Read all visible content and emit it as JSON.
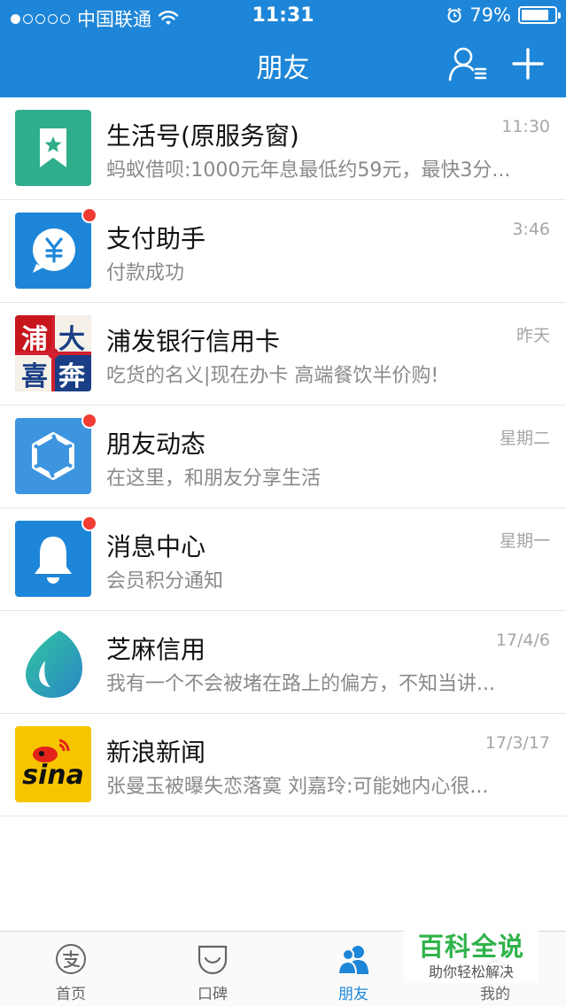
{
  "status_bar": {
    "carrier": "中国联通",
    "time": "11:31",
    "battery": "79%"
  },
  "nav": {
    "title": "朋友"
  },
  "conversations": [
    {
      "title": "生活号(原服务窗)",
      "subtitle": "蚂蚁借呗:1000元年息最低约59元，最快3分...",
      "time": "11:30",
      "icon": "bookmark-star-icon",
      "unread": false
    },
    {
      "title": "支付助手",
      "subtitle": "付款成功",
      "time": "3:46",
      "icon": "yen-bubble-icon",
      "unread": true
    },
    {
      "title": "浦发银行信用卡",
      "subtitle": "吃货的名义|现在办卡 高端餐饮半价购!",
      "time": "昨天",
      "icon": "spdb-promo-image",
      "unread": false,
      "avatar_text": [
        "浦",
        "大",
        "喜",
        "奔"
      ]
    },
    {
      "title": "朋友动态",
      "subtitle": "在这里，和朋友分享生活",
      "time": "星期二",
      "icon": "aperture-icon",
      "unread": true
    },
    {
      "title": "消息中心",
      "subtitle": "会员积分通知",
      "time": "星期一",
      "icon": "bell-icon",
      "unread": true
    },
    {
      "title": "芝麻信用",
      "subtitle": "我有一个不会被堵在路上的偏方，不知当讲...",
      "time": "17/4/6",
      "icon": "sesame-drop-icon",
      "unread": false
    },
    {
      "title": "新浪新闻",
      "subtitle": "张曼玉被曝失恋落寞 刘嘉玲:可能她内心很...",
      "time": "17/3/17",
      "icon": "sina-logo",
      "unread": false,
      "avatar_text": [
        "sina"
      ]
    }
  ],
  "tabs": [
    {
      "label": "首页",
      "icon": "alipay-icon",
      "active": false
    },
    {
      "label": "口碑",
      "icon": "koubei-icon",
      "active": false
    },
    {
      "label": "朋友",
      "icon": "friends-icon",
      "active": true
    },
    {
      "label": "我的",
      "icon": "profile-icon",
      "active": false
    }
  ],
  "watermark": {
    "title": "百科全说",
    "subtitle": "助你轻松解决"
  },
  "colors": {
    "brand_blue": "#1e86d8",
    "badge_red": "#f23c33"
  }
}
